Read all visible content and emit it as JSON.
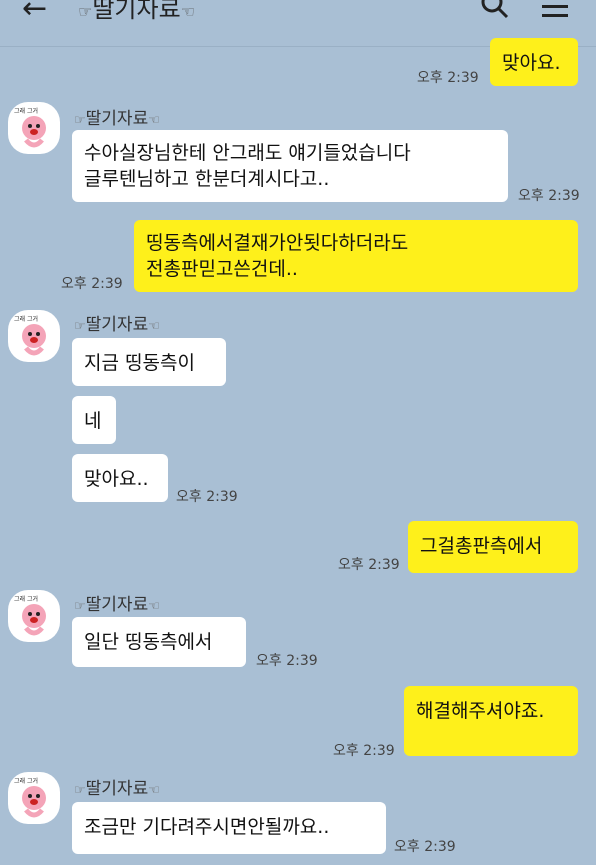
{
  "header": {
    "back_icon": "←",
    "title": "딸기자료",
    "left_hand": "☞",
    "right_hand": "☜"
  },
  "sender_name": "딸기자료",
  "avatar_text": "그래 그거",
  "messages": {
    "m0": {
      "text": "맞아요.",
      "time": "오후 2:39"
    },
    "m1": {
      "line1": "수아실장님한테 안그래도 얘기들었습니다",
      "line2": "글루텐님하고 한분더계시다고..",
      "time": "오후 2:39"
    },
    "m2": {
      "line1": "띵동측에서결재가안됫다하더라도",
      "line2": "전총판믿고쓴건데..",
      "time": "오후 2:39"
    },
    "m3": {
      "text": "지금 띵동측이"
    },
    "m4": {
      "text": "네"
    },
    "m5": {
      "text": "맞아요..",
      "time": "오후 2:39"
    },
    "m6": {
      "text": "그걸총판측에서",
      "time": "오후 2:39"
    },
    "m7": {
      "text": "일단 띵동측에서",
      "time": "오후 2:39"
    },
    "m8": {
      "text": "해결해주셔야죠.",
      "time": "오후 2:39"
    },
    "m9": {
      "text": "조금만 기다려주시면안될까요..",
      "time": "오후 2:39"
    }
  }
}
